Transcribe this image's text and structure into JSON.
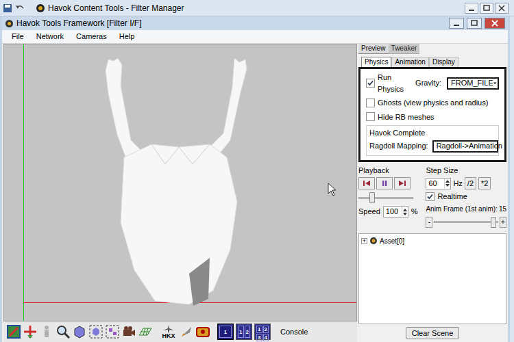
{
  "background_window": {
    "title": "Havok Content Tools - Filter Manager"
  },
  "window": {
    "title": "Havok Tools Framework [Filter I/F]"
  },
  "menu": [
    "File",
    "Network",
    "Cameras",
    "Help"
  ],
  "panel_tabs": [
    {
      "label": "Preview",
      "selected": true
    },
    {
      "label": "Tweaker",
      "selected": false
    }
  ],
  "sub_tabs": [
    {
      "label": "Physics",
      "selected": true
    },
    {
      "label": "Animation",
      "selected": false
    },
    {
      "label": "Display",
      "selected": false
    }
  ],
  "physics": {
    "run_physics": {
      "label": "Run Physics",
      "checked": true
    },
    "gravity": {
      "label": "Gravity:",
      "value": "FROM_FILE"
    },
    "ghosts": {
      "label": "Ghosts (view physics and radius)",
      "checked": false
    },
    "hide_rb": {
      "label": "Hide RB meshes",
      "checked": false
    },
    "group": {
      "title": "Havok Complete",
      "label": "Ragdoll Mapping:",
      "value": "Ragdoll->Animation"
    }
  },
  "playback": {
    "title": "Playback",
    "level": 0.25,
    "speed": {
      "label": "Speed",
      "value": "100",
      "unit": "%"
    }
  },
  "step_size": {
    "title": "Step Size",
    "value": "60",
    "unit": "Hz",
    "buttons": [
      "/2",
      "*2"
    ],
    "realtime": {
      "label": "Realtime",
      "checked": true
    }
  },
  "anim_frame": {
    "label": "Anim Frame (1st anim):",
    "value": "15",
    "level": 0.92,
    "minus": "-",
    "plus": "+"
  },
  "tree": [
    {
      "label": "Asset[0]",
      "expander": "+",
      "expanded": false
    }
  ],
  "clear_button": "Clear Scene",
  "toolbar": {
    "hkx": "HKX",
    "views": [
      {
        "cells": [
          "1"
        ],
        "selected": true
      },
      {
        "cells": [
          "1",
          "2"
        ],
        "selected": false
      },
      {
        "cells": [
          "1",
          "2",
          "3",
          "4"
        ],
        "selected": false
      }
    ],
    "console": "Console"
  }
}
